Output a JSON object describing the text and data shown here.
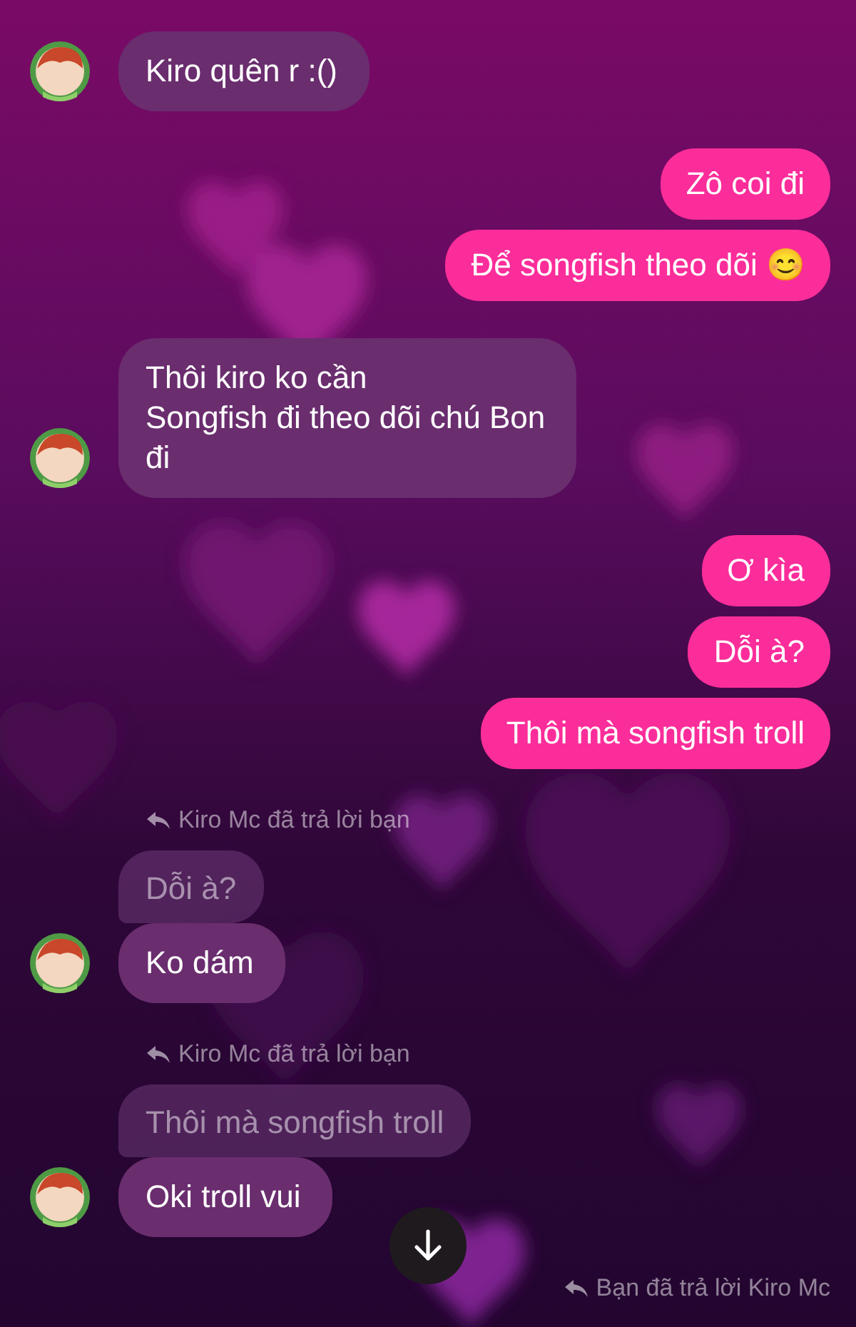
{
  "conversation": [
    {
      "kind": "incoming",
      "messages": [
        "Kiro quên r :()"
      ]
    },
    {
      "kind": "outgoing",
      "messages": [
        "Zô coi đi",
        "Để songfish theo dõi 😊"
      ]
    },
    {
      "kind": "incoming",
      "messages": [
        "Thôi kiro ko cần\nSongfish đi theo dõi chú Bon\nđi"
      ]
    },
    {
      "kind": "outgoing",
      "messages": [
        "Ơ kìa",
        "Dỗi à?",
        "Thôi mà songfish troll"
      ]
    },
    {
      "kind": "incoming",
      "reply_note": "Kiro Mc đã trả lời bạn",
      "quote": "Dỗi à?",
      "messages": [
        "Ko dám"
      ]
    },
    {
      "kind": "incoming",
      "reply_note": "Kiro Mc đã trả lời bạn",
      "quote": "Thôi mà songfish troll",
      "messages": [
        "Oki troll vui"
      ]
    },
    {
      "kind": "outgoing",
      "reply_note": "Bạn đã trả lời Kiro Mc"
    }
  ]
}
